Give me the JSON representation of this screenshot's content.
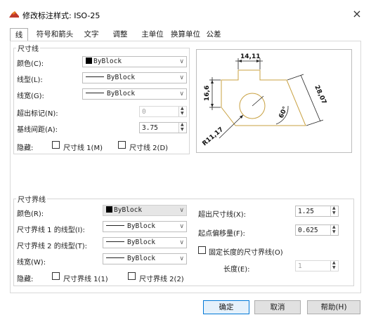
{
  "window": {
    "title": "修改标注样式: ISO-25",
    "close_symbol": "×"
  },
  "tabs": [
    {
      "label": "线",
      "active": true
    },
    {
      "label": "符号和箭头"
    },
    {
      "label": "文字"
    },
    {
      "label": "调整"
    },
    {
      "label": "主单位"
    },
    {
      "label": "换算单位"
    },
    {
      "label": "公差"
    }
  ],
  "dim_lines": {
    "group_title": "尺寸线",
    "color_label": "颜色(C):",
    "color_value": "ByBlock",
    "linetype_label": "线型(L):",
    "linetype_value": "ByBlock",
    "lineweight_label": "线宽(G):",
    "lineweight_value": "ByBlock",
    "extend_ticks_label": "超出标记(N):",
    "extend_ticks_value": "0",
    "baseline_label": "基线间距(A):",
    "baseline_value": "3.75",
    "suppress_label": "隐藏:",
    "suppress_1": "尺寸线 1(M)",
    "suppress_2": "尺寸线 2(D)"
  },
  "ext_lines": {
    "group_title": "尺寸界线",
    "color_label": "颜色(R):",
    "color_value": "ByBlock",
    "linetype1_label": "尺寸界线 1 的线型(I):",
    "linetype1_value": "ByBlock",
    "linetype2_label": "尺寸界线 2 的线型(T):",
    "linetype2_value": "ByBlock",
    "lineweight_label": "线宽(W):",
    "lineweight_value": "ByBlock",
    "suppress_label": "隐藏:",
    "suppress_1": "尺寸界线 1(1)",
    "suppress_2": "尺寸界线 2(2)",
    "extend_label": "超出尺寸线(X):",
    "extend_value": "1.25",
    "offset_label": "起点偏移量(F):",
    "offset_value": "0.625",
    "fixed_length_label": "固定长度的尺寸界线(O)",
    "length_label": "长度(E):",
    "length_value": "1"
  },
  "preview": {
    "dim_top": "14,11",
    "dim_left": "16,6",
    "dim_right": "28,07",
    "dim_angle": "60°",
    "dim_radius": "R11,17"
  },
  "buttons": {
    "ok": "确定",
    "cancel": "取消",
    "help": "帮助(H)"
  },
  "colors": {
    "accent": "#0078d7",
    "preview_shape": "#c8a040"
  }
}
